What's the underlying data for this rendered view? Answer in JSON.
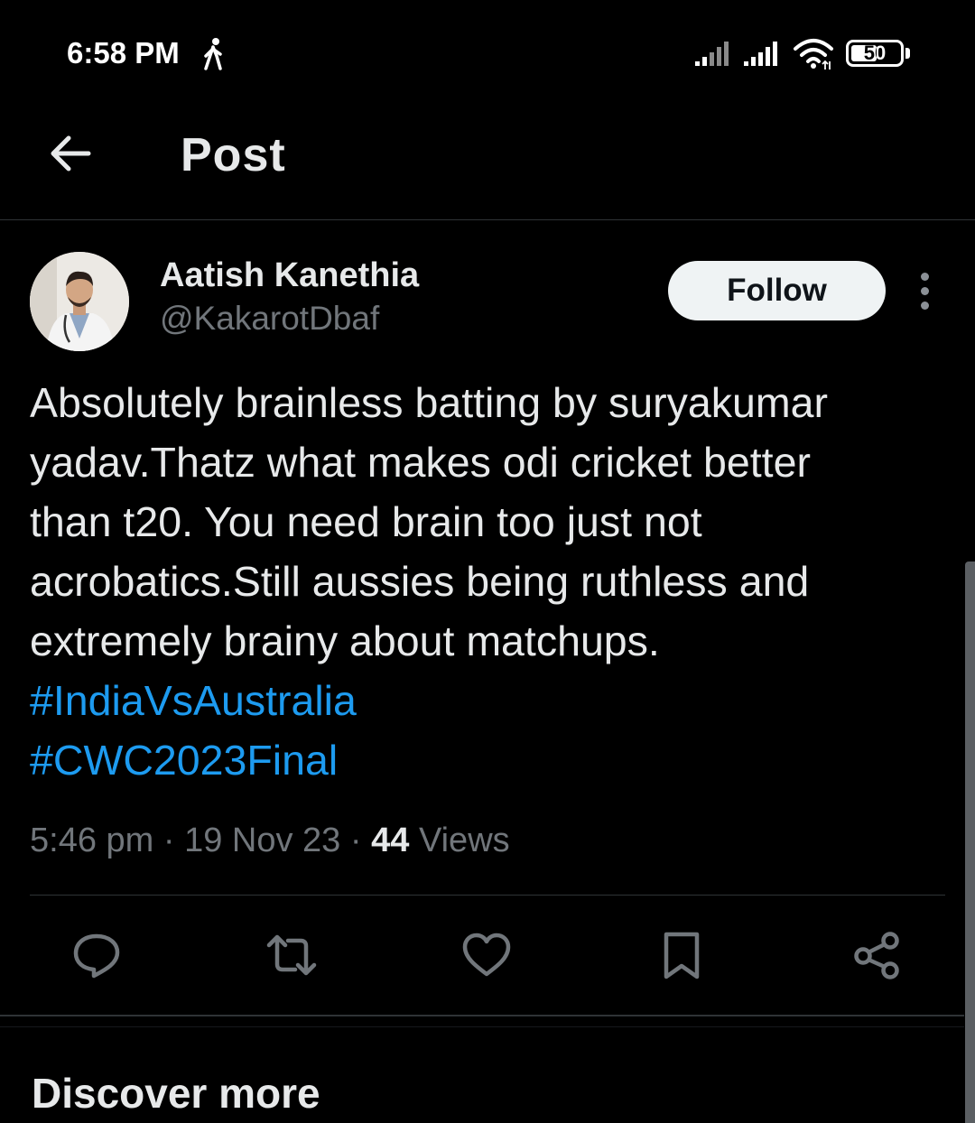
{
  "status_bar": {
    "time": "6:58 PM",
    "battery": "50",
    "icons": [
      "walking-icon",
      "signal-icon",
      "signal-icon",
      "wifi-icon",
      "battery-icon"
    ]
  },
  "header": {
    "title": "Post",
    "back_icon": "arrow-left-icon"
  },
  "post": {
    "author": {
      "name": "Aatish Kanethia",
      "handle": "@KakarotDbaf"
    },
    "follow_label": "Follow",
    "text_lines": [
      "Absolutely brainless batting by suryakumar",
      "yadav.Thatz what makes odi cricket better",
      "than t20. You need brain too just not",
      "acrobatics.Still aussies being ruthless and",
      "extremely brainy about matchups."
    ],
    "hashtags": [
      "#IndiaVsAustralia",
      "#CWC2023Final"
    ],
    "time": "5:46 pm",
    "separator": "·",
    "date": "19 Nov 23",
    "views_count": "44",
    "views_label": "Views",
    "action_icons": [
      "reply-icon",
      "retweet-icon",
      "like-icon",
      "bookmark-icon",
      "share-icon"
    ]
  },
  "colors": {
    "background": "#000000",
    "text": "#e7e9ea",
    "secondary": "#71767b",
    "hashtag": "#1d9bf0"
  },
  "discover": {
    "title": "Discover more"
  }
}
